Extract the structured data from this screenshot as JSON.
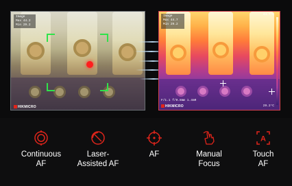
{
  "left_image": {
    "title": "Image",
    "max_label": "Max",
    "max_value": "44.2",
    "min_label": "Min",
    "min_value": "29.2",
    "brand": "HIKMICRO"
  },
  "right_image": {
    "title": "Image",
    "max_label": "Max",
    "max_value": "44.7",
    "min_label": "Min",
    "min_value": "29.2",
    "scale_top": "44.7°C",
    "scale_bottom": "29.2°C",
    "footer_info": "F/1.1 f/0.8mm 1.4mR",
    "brand": "HIKMICRO"
  },
  "features": [
    {
      "icon": "continuous-af-icon",
      "line1": "Continuous",
      "line2": "AF"
    },
    {
      "icon": "laser-assisted-af-icon",
      "line1": "Laser-",
      "line2": "Assisted AF"
    },
    {
      "icon": "af-crosshair-icon",
      "line1": "AF",
      "line2": ""
    },
    {
      "icon": "manual-focus-hand-icon",
      "line1": "Manual",
      "line2": "Focus"
    },
    {
      "icon": "touch-af-icon",
      "line1": "Touch",
      "line2": "AF"
    }
  ],
  "colors": {
    "accent_red": "#e1251b",
    "focus_green": "#2fe34a"
  }
}
